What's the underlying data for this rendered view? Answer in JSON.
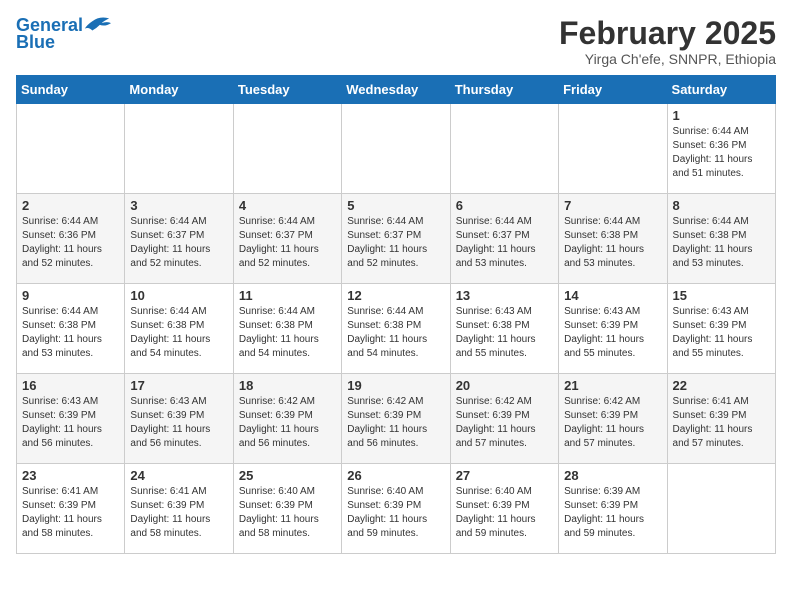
{
  "header": {
    "logo_line1": "General",
    "logo_line2": "Blue",
    "month": "February 2025",
    "location": "Yirga Ch'efe, SNNPR, Ethiopia"
  },
  "days_of_week": [
    "Sunday",
    "Monday",
    "Tuesday",
    "Wednesday",
    "Thursday",
    "Friday",
    "Saturday"
  ],
  "weeks": [
    [
      {
        "day": "",
        "text": ""
      },
      {
        "day": "",
        "text": ""
      },
      {
        "day": "",
        "text": ""
      },
      {
        "day": "",
        "text": ""
      },
      {
        "day": "",
        "text": ""
      },
      {
        "day": "",
        "text": ""
      },
      {
        "day": "1",
        "text": "Sunrise: 6:44 AM\nSunset: 6:36 PM\nDaylight: 11 hours\nand 51 minutes."
      }
    ],
    [
      {
        "day": "2",
        "text": "Sunrise: 6:44 AM\nSunset: 6:36 PM\nDaylight: 11 hours\nand 52 minutes."
      },
      {
        "day": "3",
        "text": "Sunrise: 6:44 AM\nSunset: 6:37 PM\nDaylight: 11 hours\nand 52 minutes."
      },
      {
        "day": "4",
        "text": "Sunrise: 6:44 AM\nSunset: 6:37 PM\nDaylight: 11 hours\nand 52 minutes."
      },
      {
        "day": "5",
        "text": "Sunrise: 6:44 AM\nSunset: 6:37 PM\nDaylight: 11 hours\nand 52 minutes."
      },
      {
        "day": "6",
        "text": "Sunrise: 6:44 AM\nSunset: 6:37 PM\nDaylight: 11 hours\nand 53 minutes."
      },
      {
        "day": "7",
        "text": "Sunrise: 6:44 AM\nSunset: 6:38 PM\nDaylight: 11 hours\nand 53 minutes."
      },
      {
        "day": "8",
        "text": "Sunrise: 6:44 AM\nSunset: 6:38 PM\nDaylight: 11 hours\nand 53 minutes."
      }
    ],
    [
      {
        "day": "9",
        "text": "Sunrise: 6:44 AM\nSunset: 6:38 PM\nDaylight: 11 hours\nand 53 minutes."
      },
      {
        "day": "10",
        "text": "Sunrise: 6:44 AM\nSunset: 6:38 PM\nDaylight: 11 hours\nand 54 minutes."
      },
      {
        "day": "11",
        "text": "Sunrise: 6:44 AM\nSunset: 6:38 PM\nDaylight: 11 hours\nand 54 minutes."
      },
      {
        "day": "12",
        "text": "Sunrise: 6:44 AM\nSunset: 6:38 PM\nDaylight: 11 hours\nand 54 minutes."
      },
      {
        "day": "13",
        "text": "Sunrise: 6:43 AM\nSunset: 6:38 PM\nDaylight: 11 hours\nand 55 minutes."
      },
      {
        "day": "14",
        "text": "Sunrise: 6:43 AM\nSunset: 6:39 PM\nDaylight: 11 hours\nand 55 minutes."
      },
      {
        "day": "15",
        "text": "Sunrise: 6:43 AM\nSunset: 6:39 PM\nDaylight: 11 hours\nand 55 minutes."
      }
    ],
    [
      {
        "day": "16",
        "text": "Sunrise: 6:43 AM\nSunset: 6:39 PM\nDaylight: 11 hours\nand 56 minutes."
      },
      {
        "day": "17",
        "text": "Sunrise: 6:43 AM\nSunset: 6:39 PM\nDaylight: 11 hours\nand 56 minutes."
      },
      {
        "day": "18",
        "text": "Sunrise: 6:42 AM\nSunset: 6:39 PM\nDaylight: 11 hours\nand 56 minutes."
      },
      {
        "day": "19",
        "text": "Sunrise: 6:42 AM\nSunset: 6:39 PM\nDaylight: 11 hours\nand 56 minutes."
      },
      {
        "day": "20",
        "text": "Sunrise: 6:42 AM\nSunset: 6:39 PM\nDaylight: 11 hours\nand 57 minutes."
      },
      {
        "day": "21",
        "text": "Sunrise: 6:42 AM\nSunset: 6:39 PM\nDaylight: 11 hours\nand 57 minutes."
      },
      {
        "day": "22",
        "text": "Sunrise: 6:41 AM\nSunset: 6:39 PM\nDaylight: 11 hours\nand 57 minutes."
      }
    ],
    [
      {
        "day": "23",
        "text": "Sunrise: 6:41 AM\nSunset: 6:39 PM\nDaylight: 11 hours\nand 58 minutes."
      },
      {
        "day": "24",
        "text": "Sunrise: 6:41 AM\nSunset: 6:39 PM\nDaylight: 11 hours\nand 58 minutes."
      },
      {
        "day": "25",
        "text": "Sunrise: 6:40 AM\nSunset: 6:39 PM\nDaylight: 11 hours\nand 58 minutes."
      },
      {
        "day": "26",
        "text": "Sunrise: 6:40 AM\nSunset: 6:39 PM\nDaylight: 11 hours\nand 59 minutes."
      },
      {
        "day": "27",
        "text": "Sunrise: 6:40 AM\nSunset: 6:39 PM\nDaylight: 11 hours\nand 59 minutes."
      },
      {
        "day": "28",
        "text": "Sunrise: 6:39 AM\nSunset: 6:39 PM\nDaylight: 11 hours\nand 59 minutes."
      },
      {
        "day": "",
        "text": ""
      }
    ]
  ]
}
